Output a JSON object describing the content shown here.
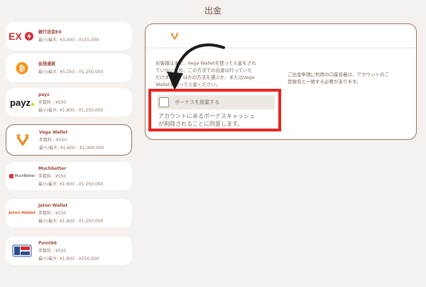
{
  "page": {
    "title": "出金"
  },
  "methods": [
    {
      "name": "銀行送金EX",
      "fee": "",
      "limit": "最小/最大: ¥3,000 - ¥155,000",
      "logo_text": "EX",
      "icon": "bank-ex-logo"
    },
    {
      "name": "仮想通貨",
      "fee": "",
      "limit": "最小/最大: ¥5,250 - ¥1,250,000",
      "logo_text": "",
      "icon": "bitcoin-icon"
    },
    {
      "name": "payz",
      "fee": "手数料 : ¥550",
      "limit": "最小/最大: ¥1,600 - ¥1,250,000",
      "logo_text": "payz",
      "icon": "payz-logo"
    },
    {
      "name": "Vega Wallet",
      "fee": "手数料 : ¥550",
      "limit": "最小/最大: ¥1,600 - ¥1,000,000",
      "logo_text": "",
      "icon": "vega-wallet-logo",
      "selected": true
    },
    {
      "name": "Muchbetter",
      "fee": "手数料 : ¥550",
      "limit": "最小/最大: ¥1,600 - ¥1,250,000",
      "logo_text": "MuchBetter",
      "icon": "muchbetter-logo"
    },
    {
      "name": "Jeton Wallet",
      "fee": "手数料 : ¥550",
      "limit": "最小/最大: ¥1,600 - ¥1,250,000",
      "logo_text": "Jeton Wallet",
      "icon": "jeton-logo"
    },
    {
      "name": "Point66",
      "fee": "手数料 : ¥550",
      "limit": "最小/最大: ¥1,600 - ¥250,000",
      "logo_text": "",
      "icon": "point66-logo"
    }
  ],
  "detail": {
    "notice_lines": [
      "お客様はまだ、Vega Walletを使って入金をされ",
      "ていないため、この方法での出金は行っていた",
      "だけません。ほかの方法を選ぶか、またはVega",
      "Walletを使って入金ください。"
    ],
    "info_lines": [
      "ご出金申請に利用の口座名義は、アカウントのご",
      "登録名と一致する必要があります。"
    ],
    "bonus_label": "ボーナスを放棄する",
    "agree_lines": [
      "アカウントにあるボーナスキャッシュ",
      "が削除されることに同意します。"
    ]
  },
  "colors": {
    "accent": "#9a7557",
    "highlight": "#e8241f",
    "brand_orange": "#e0922b",
    "background": "#f4f1ee"
  }
}
